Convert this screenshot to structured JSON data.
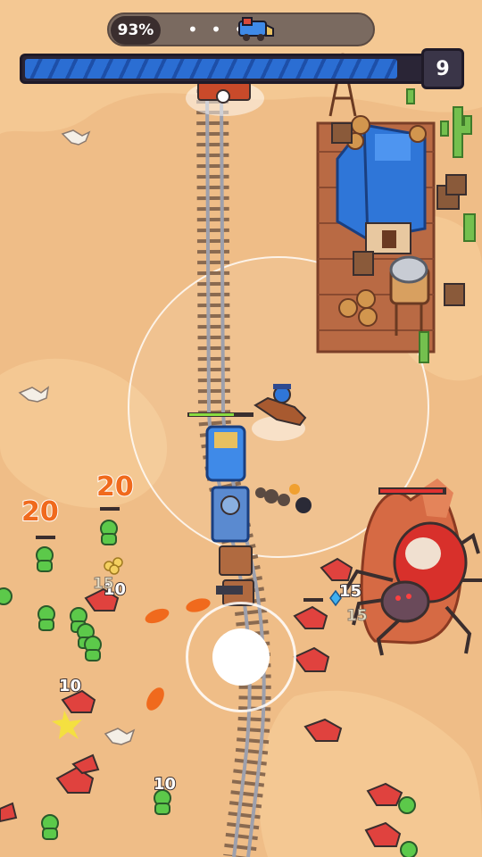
{
  "hud": {
    "progress_label": "93%",
    "progress_dots": "• • •",
    "train_icon": "train-icon",
    "level": "9",
    "health_fraction": 0.93
  },
  "damage_numbers": {
    "left_large_a": "20",
    "left_large_b": "20",
    "mid_10_a": "10",
    "mid_15_a": "15",
    "lower_10_a": "10",
    "lower_10_b": "10",
    "right_15_a": "15",
    "right_15_b": "15"
  },
  "colors": {
    "sand": "#efbd87",
    "track": "#9a9aa6",
    "enemy_red": "#e0423e",
    "enemy_green": "#5cc94a",
    "boss_shell": "#d8302b",
    "roof_blue": "#2f76d8"
  },
  "icons": [
    "train-icon",
    "cow-skull-icon",
    "cactus-icon",
    "crate-icon",
    "barrel-icon",
    "water-tower-icon",
    "windmill-icon",
    "coin-pile-icon",
    "gem-icon"
  ]
}
